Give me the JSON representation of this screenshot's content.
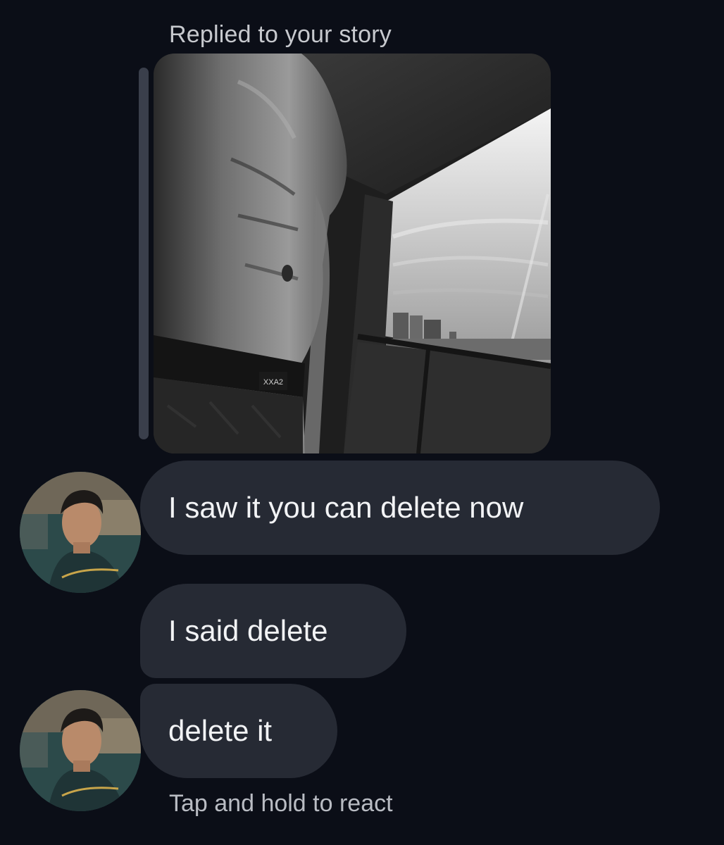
{
  "reply_header": {
    "label": "Replied to your story"
  },
  "story": {
    "icon": "story-photo-thumbnail",
    "waistband_text": "XXA2"
  },
  "messages": [
    {
      "text": "I saw it you can delete now"
    },
    {
      "text": "I said delete"
    },
    {
      "text": "delete it"
    }
  ],
  "avatar": {
    "icon": "user-avatar"
  },
  "footer": {
    "hint": "Tap and hold to react"
  },
  "colors": {
    "background": "#0b0e17",
    "bubble": "#262a34",
    "reply_bar": "#3a3f4b",
    "muted_text": "#c7c9ce"
  }
}
